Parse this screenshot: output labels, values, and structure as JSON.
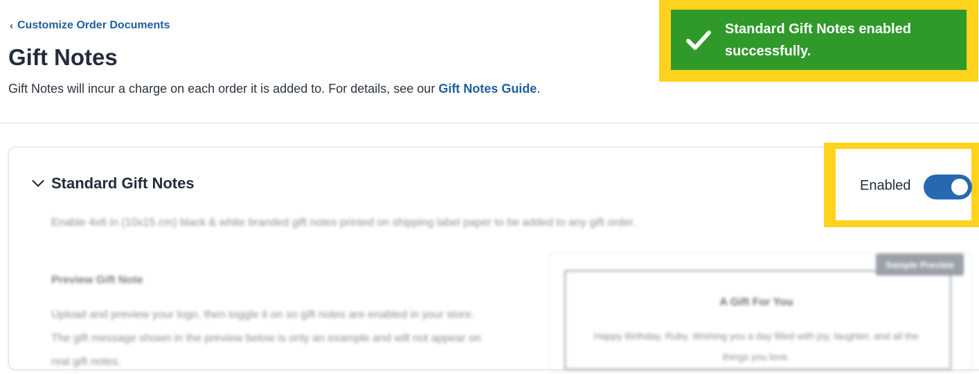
{
  "breadcrumb": {
    "label": "Customize Order Documents"
  },
  "page": {
    "title": "Gift Notes",
    "intro_text": "Gift Notes will incur a charge on each order it is added to. For details, see our ",
    "intro_link": "Gift Notes Guide",
    "intro_end": "."
  },
  "toast": {
    "message": "Standard Gift Notes enabled successfully."
  },
  "section": {
    "title": "Standard Gift Notes",
    "toggle_label": "Enabled",
    "toggle_on": true,
    "description": "Enable 4x6 in (10x15 cm) black & white branded gift notes printed on shipping label paper to be added to any gift order.",
    "preview_heading": "Preview Gift Note",
    "preview_text": "Upload and preview your logo, then toggle it on so gift notes are enabled in your store. The gift message shown in the preview below is only an example and will not appear on real gift notes."
  },
  "preview": {
    "tag": "Sample Preview",
    "note_title": "A Gift For You",
    "note_body": "Happy Birthday, Ruby. Wishing you a day filled with joy, laughter, and all the things you love."
  },
  "colors": {
    "accent": "#1f5f9e",
    "toast_bg": "#2f9a2a",
    "highlight": "#ffd21e",
    "toggle_on": "#2669b0"
  }
}
